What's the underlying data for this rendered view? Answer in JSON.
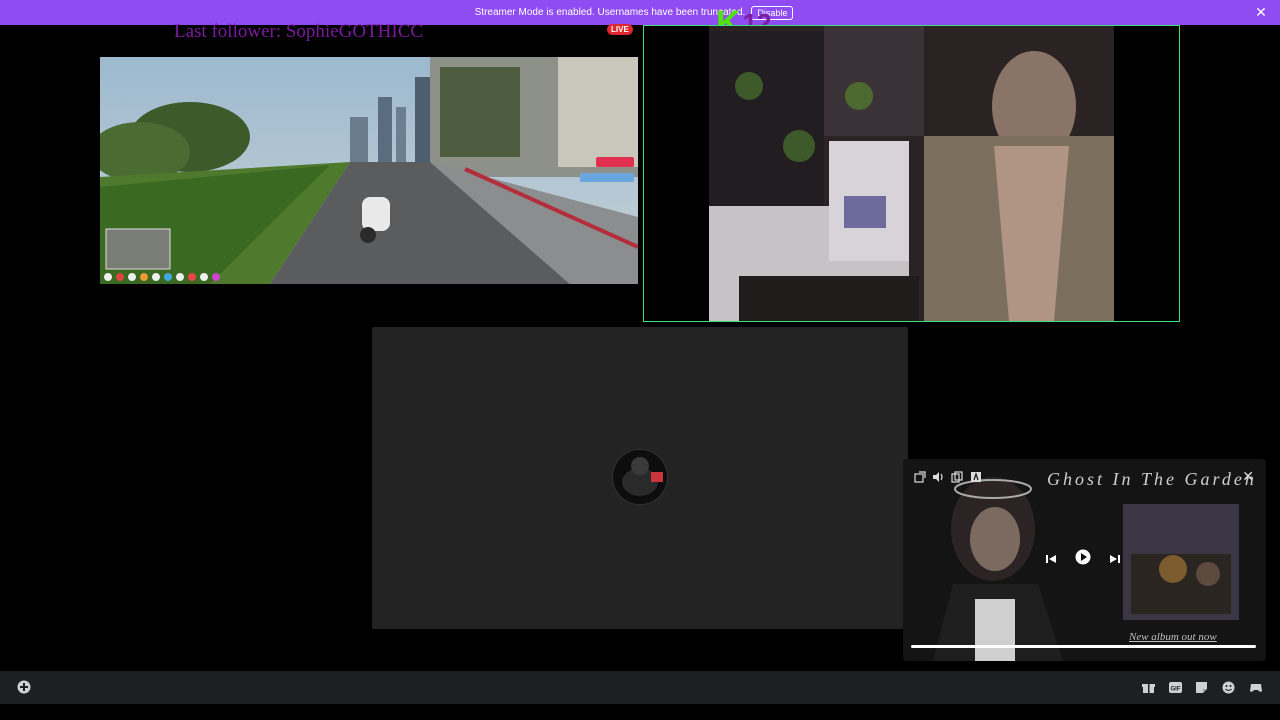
{
  "banner": {
    "message": "Streamer Mode is enabled. Usernames have been truncated.",
    "disable_label": "Disable",
    "close_icon": "close-icon"
  },
  "overlay": {
    "last_follower": "Last follower: SophieGOTHICC",
    "live_badge": "LIVE",
    "channel_logo_letter": "K",
    "channel_logo_number": "12"
  },
  "game_tile": {
    "description": "GTA gameplay stream"
  },
  "music_player": {
    "title": "Ghost In The Garden",
    "subtitle": "New album out now",
    "progress": 1.0,
    "toolbar_icons": [
      "popout-icon",
      "volume-icon",
      "copy-icon",
      "lyrics-icon"
    ],
    "controls": [
      "previous-icon",
      "play-icon",
      "next-icon"
    ]
  },
  "bottombar": {
    "left_icon": "plus-icon",
    "right_icons": [
      "gift-icon",
      "gif-icon",
      "sticker-icon",
      "emoji-icon",
      "activity-icon"
    ]
  },
  "colors": {
    "banner": "#8e4cf2",
    "live": "#e0262e",
    "cam_border": "#3ae27a",
    "follower_text": "#7b1a9d",
    "logo_green": "#51e20b"
  }
}
